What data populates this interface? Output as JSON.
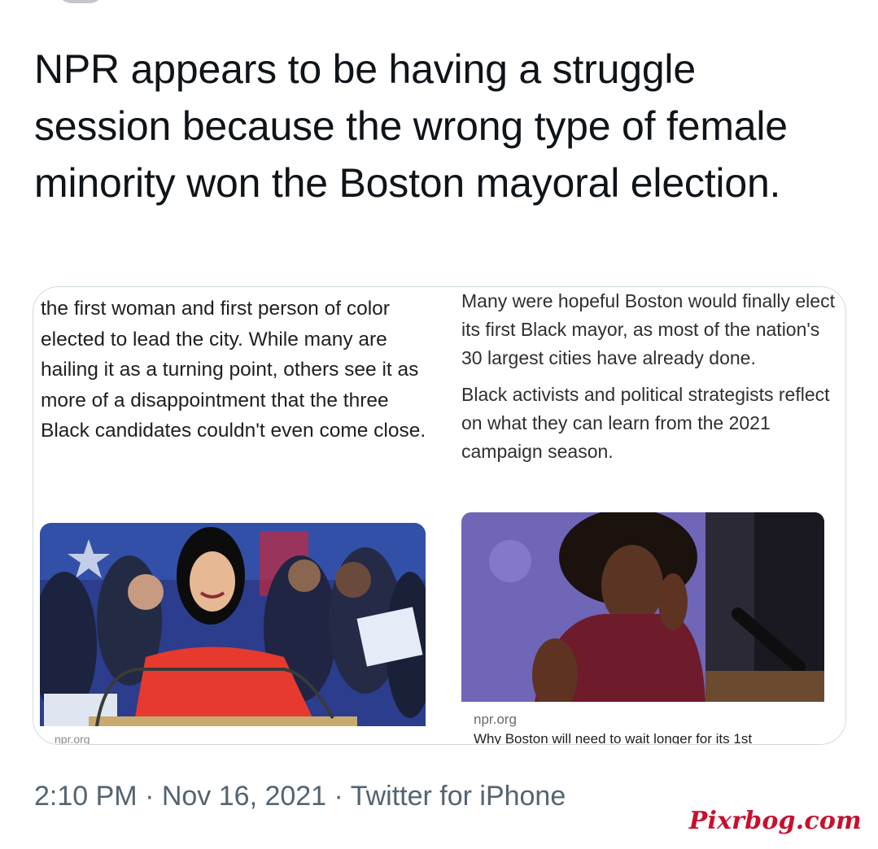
{
  "tweet": {
    "text": "NPR appears to be having a struggle session because the wrong type of female minority won the Boston mayoral election.",
    "timestamp": "2:10 PM · Nov 16, 2021 · Twitter for iPhone"
  },
  "card": {
    "left": {
      "excerpt": "the first woman and first person of color elected to lead the city. While many are hailing it as a turning point, others see it as more of a disappointment that the three Black candidates couldn't even come close.",
      "source": "npr.org"
    },
    "right": {
      "paragraph1": "Many were hopeful Boston would finally elect its first Black mayor, as most of the nation's 30 largest cities have already done.",
      "paragraph2": "Black activists and political strategists reflect on what they can learn from the 2021 campaign season.",
      "source": "npr.org",
      "headline": "Why Boston will need to wait longer for its 1st"
    }
  },
  "watermark": "Pixrbog.com",
  "colors": {
    "text": "#0f1419",
    "meta": "#536471",
    "border": "#cfd9de",
    "watermark": "#c8102e"
  }
}
